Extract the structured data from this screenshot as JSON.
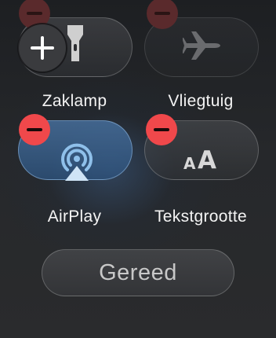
{
  "controls": [
    {
      "label": "Zaklamp",
      "icon": "flashlight-icon",
      "state": "inactive"
    },
    {
      "label": "Vliegtuig",
      "icon": "airplane-icon",
      "state": "inactive"
    },
    {
      "label": "AirPlay",
      "icon": "airplay-icon",
      "state": "active"
    },
    {
      "label": "Tekstgrootte",
      "icon": "text-size-icon",
      "state": "inactive",
      "glyph_small": "A",
      "glyph_large": "A"
    }
  ],
  "add_badge": {
    "icon": "plus-icon"
  },
  "remove_badge": {
    "icon": "minus-icon"
  },
  "done_button": {
    "label": "Gereed"
  },
  "colors": {
    "remove_badge": "#f0484b",
    "active_tile": "#46709b",
    "background": "#26282b"
  }
}
